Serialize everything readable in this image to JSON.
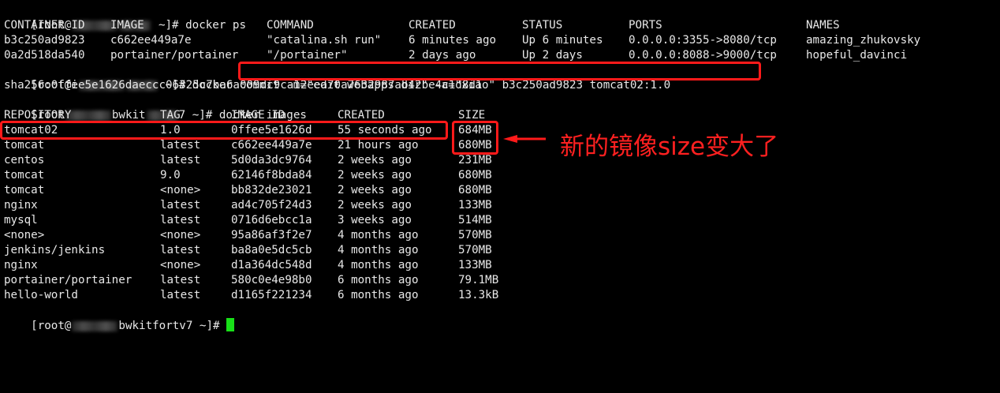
{
  "terminal": {
    "cmd1": {
      "prompt_user": "[root@",
      "prompt_tail": " ~]# ",
      "command": "docker ps"
    },
    "ps_headers": [
      "CONTAINER ID",
      "IMAGE",
      "COMMAND",
      "CREATED",
      "STATUS",
      "PORTS",
      "NAMES"
    ],
    "ps_rows": [
      [
        "b3c250ad9823",
        "c662ee449a7e",
        "\"catalina.sh run\"",
        "6 minutes ago",
        "Up 6 minutes",
        "0.0.0.0:3355->8080/tcp",
        "amazing_zhukovsky"
      ],
      [
        "0a2d518da540",
        "portainer/portainer",
        "\"/portainer\"",
        "2 days ago",
        "Up 2 days",
        "0.0.0.0:8088->9000/tcp",
        "hopeful_davinci"
      ]
    ],
    "cmd2": {
      "prompt": "[root@i",
      "prompt_tail": " ~]# ",
      "command": "docker commit -m=\"edit webapps dir\" -a=\"xiao\" b3c250ad9823 tomcat02:1.0"
    },
    "sha_output": "sha256:0ffee5e1626daeccc06325c7ba6a009dc9ca12eea70a7632987ab42be4c1d8d1",
    "cmd3": {
      "prompt": "[root",
      "prompt_mid": "bwkit",
      "prompt_tail": "7 ~]# ",
      "command": "docker images"
    },
    "img_headers": [
      "REPOSITORY",
      "TAG",
      "IMAGE ID",
      "CREATED",
      "SIZE"
    ],
    "img_rows": [
      [
        "tomcat02",
        "1.0",
        "0ffee5e1626d",
        "55 seconds ago",
        "684MB"
      ],
      [
        "tomcat",
        "latest",
        "c662ee449a7e",
        "21 hours ago",
        "680MB"
      ],
      [
        "centos",
        "latest",
        "5d0da3dc9764",
        "2 weeks ago",
        "231MB"
      ],
      [
        "tomcat",
        "9.0",
        "62146f8bda84",
        "2 weeks ago",
        "680MB"
      ],
      [
        "tomcat",
        "<none>",
        "bb832de23021",
        "2 weeks ago",
        "680MB"
      ],
      [
        "nginx",
        "latest",
        "ad4c705f24d3",
        "2 weeks ago",
        "133MB"
      ],
      [
        "mysql",
        "latest",
        "0716d6ebcc1a",
        "3 weeks ago",
        "514MB"
      ],
      [
        "<none>",
        "<none>",
        "95a86af3f2e7",
        "4 months ago",
        "570MB"
      ],
      [
        "jenkins/jenkins",
        "latest",
        "ba8a0e5dc5cb",
        "4 months ago",
        "570MB"
      ],
      [
        "nginx",
        "<none>",
        "d1a364dc548d",
        "4 months ago",
        "133MB"
      ],
      [
        "portainer/portainer",
        "latest",
        "580c0e4e98b0",
        "6 months ago",
        "79.1MB"
      ],
      [
        "hello-world",
        "latest",
        "d1165f221234",
        "6 months ago",
        "13.3kB"
      ]
    ],
    "final_prompt": {
      "prompt": "[root@",
      "prompt_mid": "bwkitfortv7",
      "prompt_tail": " ~]# "
    }
  },
  "annotation": {
    "text": "新的镜像size变大了",
    "color": "#ff2020"
  },
  "colors": {
    "background": "#000000",
    "text": "#e8e8e8",
    "highlight": "#ff1a1a",
    "cursor": "#18e018"
  }
}
